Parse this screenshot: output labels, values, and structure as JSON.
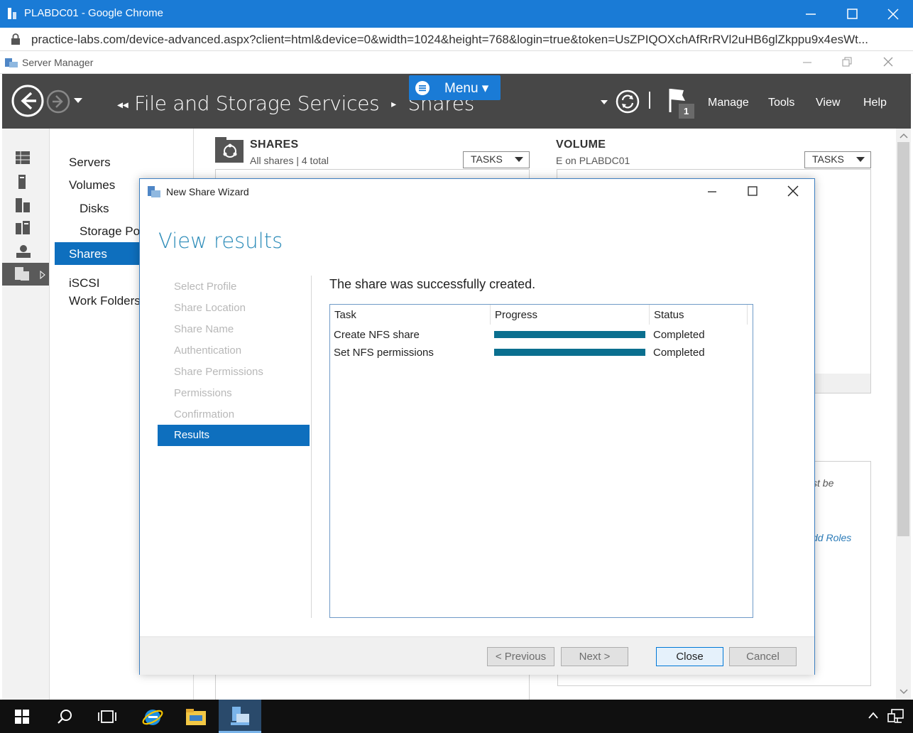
{
  "browser": {
    "title": "PLABDC01 - Google Chrome",
    "url": "practice-labs.com/device-advanced.aspx?client=html&device=0&width=1024&height=768&login=true&token=UsZPIQOXchAfRrRVl2uHB6glZkppu9x4esWt..."
  },
  "server_manager": {
    "window_title": "Server Manager",
    "breadcrumb": {
      "section": "File and Storage Services",
      "separator": "▸",
      "page": "Shares"
    },
    "menu_overlay": "Menu ▾",
    "notification_count": "1",
    "header_menu": [
      "Manage",
      "Tools",
      "View",
      "Help"
    ],
    "nav": {
      "servers": "Servers",
      "volumes": "Volumes",
      "disks": "Disks",
      "storage_pools": "Storage Po",
      "shares": "Shares",
      "iscsi": "iSCSI",
      "work_folders": "Work Folders"
    },
    "shares_tile": {
      "title": "SHARES",
      "subtitle": "All shares | 4 total",
      "tasks": "TASKS"
    },
    "volume_tile": {
      "title": "VOLUME",
      "subtitle": "E on PLABDC01",
      "tasks": "TASKS"
    },
    "partial_text": {
      "must_be": "st be",
      "add_roles": "dd Roles"
    }
  },
  "wizard": {
    "title": "New Share Wizard",
    "heading": "View results",
    "steps": {
      "select_profile": "Select Profile",
      "share_location": "Share Location",
      "share_name": "Share Name",
      "authentication": "Authentication",
      "share_permissions": "Share Permissions",
      "permissions": "Permissions",
      "confirmation": "Confirmation",
      "results": "Results"
    },
    "message": "The share was successfully created.",
    "table": {
      "headers": {
        "task": "Task",
        "progress": "Progress",
        "status": "Status"
      },
      "rows": [
        {
          "task": "Create NFS share",
          "progress": 1.0,
          "status": "Completed"
        },
        {
          "task": "Set NFS permissions",
          "progress": 1.0,
          "status": "Completed"
        }
      ]
    },
    "buttons": {
      "previous": "< Previous",
      "next": "Next >",
      "close": "Close",
      "cancel": "Cancel"
    }
  },
  "colors": {
    "accent": "#0e6fbe",
    "chrome_blue": "#1a7bd6",
    "progress": "#0a6f8f",
    "header_dark": "#474747"
  }
}
